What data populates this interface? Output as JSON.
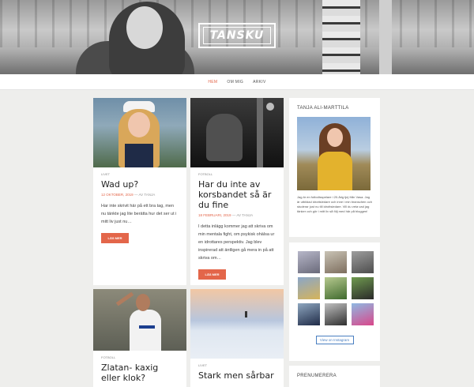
{
  "site": {
    "logo": "TANSKU"
  },
  "nav": {
    "items": [
      "HEM",
      "OM MIG",
      "ARKIV"
    ]
  },
  "posts": [
    {
      "category": "LIVET",
      "title": "Wad up?",
      "date": "12 OKTOBER, 2019",
      "author": "AV TANJA",
      "excerpt": "Har inte skrivit här på ett bra tag, men nu tänkte jag lite berätta hur det ser ut i mitt liv just nu…",
      "button": "LÄS MER"
    },
    {
      "category": "FOTBOLL",
      "title": "Har du inte av korsbandet så är du fine",
      "date": "18 FEBRUARI, 2019",
      "author": "AV TANJA",
      "excerpt": "I detta inlägg kommer jag att skriva om min mentala fight, om psykisk ohälsa ur en idrottares perspektiv. Jag blev inspirerad att äntligen gå mera in på att skriva om…",
      "button": "LÄS MER"
    },
    {
      "category": "FOTBOLL",
      "title": "Zlatan- kaxig eller klok?"
    },
    {
      "category": "LIVET",
      "title": "Stark men sårbar"
    }
  ],
  "sidebar": {
    "about_title": "TANJA ALI-MARTTILA",
    "about_text": "Jag är en fotbollsspelare i 20-årig tjej från Vasa. Jag är utbildad idrottsledare och inne i min branschen och studerar just nu till idrottsledare. Vill du veta vad jag tänker och gör i mitt liv så följ med här på bloggen!",
    "insta_button": "View on Instagram",
    "subscribe_title": "PRENUMERERA"
  },
  "colors": {
    "accent": "#e3664a",
    "instagram_button": "#4a7fc1"
  }
}
